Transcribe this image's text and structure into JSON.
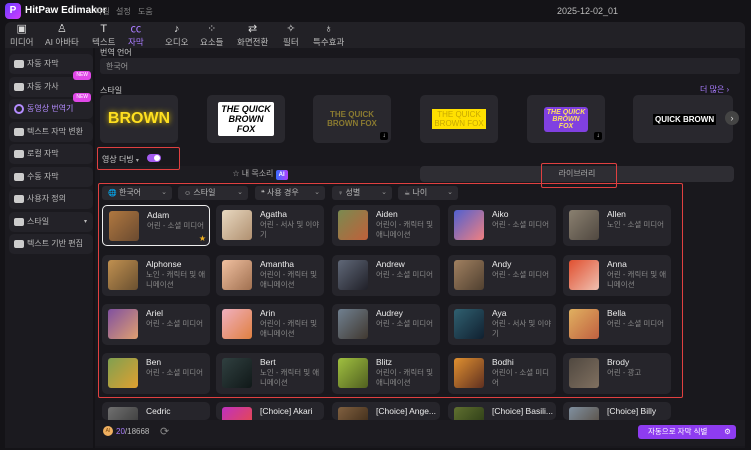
{
  "app": {
    "title": "HitPaw Edimakor",
    "menu": [
      "파일",
      "설정",
      "도움"
    ],
    "project": "2025-12-02_01"
  },
  "toolbar": [
    {
      "label": "미디어",
      "icon": "media-icon"
    },
    {
      "label": "AI 아바타",
      "icon": "avatar-icon"
    },
    {
      "label": "텍스트",
      "icon": "text-icon"
    },
    {
      "label": "자막",
      "icon": "subtitle-icon",
      "active": true
    },
    {
      "label": "오디오",
      "icon": "audio-icon"
    },
    {
      "label": "요소들",
      "icon": "elements-icon"
    },
    {
      "label": "화면전환",
      "icon": "transition-icon"
    },
    {
      "label": "필터",
      "icon": "filter-icon"
    },
    {
      "label": "특수효과",
      "icon": "effects-icon"
    }
  ],
  "sidebar": {
    "items": [
      {
        "label": "자동 자막"
      },
      {
        "label": "자동 가사",
        "badge": "NEW"
      },
      {
        "label": "동영상 번역기",
        "badge": "NEW",
        "active": true
      },
      {
        "label": "텍스트 자막 변환"
      },
      {
        "label": "로컬 자막"
      },
      {
        "label": "수동 자막"
      },
      {
        "label": "사용자 정의"
      },
      {
        "label": "스타일"
      },
      {
        "label": "텍스트 기반 편집"
      }
    ]
  },
  "main": {
    "translate_label": "번역 언어",
    "translate_value": "한국어",
    "style_label": "스타일",
    "more_label": "더 많은",
    "styles": [
      "BROWN",
      "THE QUICK BROWN FOX",
      "THE QUICK BROWN FOX",
      "THE QUICK BROWN FOX",
      "THE QUICK BROWN FOX",
      "QUICK BROWN"
    ],
    "dubbing_label": "영상 더빙",
    "dubbing_on": true,
    "tabs": {
      "my_voice": "내 목소리",
      "ai_badge": "AI",
      "library": "라이브러리"
    },
    "filters": [
      "한국어",
      "스타일",
      "사용 경우",
      "성별",
      "나이"
    ],
    "voices": [
      {
        "name": "Adam",
        "desc": "어린 - 소셜 미디어",
        "c": [
          "#b07840",
          "#6a4a30"
        ],
        "selected": true
      },
      {
        "name": "Agatha",
        "desc": "어린 - 서사 및 이야기",
        "c": [
          "#e8d8c0",
          "#b09070"
        ]
      },
      {
        "name": "Aiden",
        "desc": "어린이 - 캐릭터 및 애니메이션",
        "c": [
          "#7a8a50",
          "#c0603a"
        ]
      },
      {
        "name": "Aiko",
        "desc": "어린 - 소셜 미디어",
        "c": [
          "#5060d0",
          "#f08080"
        ]
      },
      {
        "name": "Allen",
        "desc": "노인 - 소셜 미디어",
        "c": [
          "#8a8070",
          "#504840"
        ]
      },
      {
        "name": "Alphonse",
        "desc": "노인 - 캐릭터 및 애니메이션",
        "c": [
          "#c09050",
          "#6a5030"
        ]
      },
      {
        "name": "Amantha",
        "desc": "어린이 - 캐릭터 및 애니메이션",
        "c": [
          "#f0c0a0",
          "#a07050"
        ]
      },
      {
        "name": "Andrew",
        "desc": "어린 - 소셜 미디어",
        "c": [
          "#606878",
          "#202028"
        ]
      },
      {
        "name": "Andy",
        "desc": "어린 - 소셜 미디어",
        "c": [
          "#a08060",
          "#504030"
        ]
      },
      {
        "name": "Anna",
        "desc": "어린 - 캐릭터 및 애니메이션",
        "c": [
          "#e05030",
          "#f0c0b0"
        ]
      },
      {
        "name": "Ariel",
        "desc": "어린 - 소셜 미디어",
        "c": [
          "#8050a0",
          "#e0a070"
        ]
      },
      {
        "name": "Arin",
        "desc": "어린이 - 캐릭터 및 애니메이션",
        "c": [
          "#f0b0c0",
          "#e08040"
        ]
      },
      {
        "name": "Audrey",
        "desc": "어린 - 소셜 미디어",
        "c": [
          "#708090",
          "#403830"
        ]
      },
      {
        "name": "Aya",
        "desc": "어린 - 서사 및 이야기",
        "c": [
          "#306070",
          "#102030"
        ]
      },
      {
        "name": "Bella",
        "desc": "어린 - 소셜 미디어",
        "c": [
          "#e0b060",
          "#c06040"
        ]
      },
      {
        "name": "Ben",
        "desc": "어린 - 소셜 미디어",
        "c": [
          "#80a050",
          "#e0a030"
        ]
      },
      {
        "name": "Bert",
        "desc": "노인 - 캐릭터 및 애니메이션",
        "c": [
          "#304040",
          "#101818"
        ]
      },
      {
        "name": "Blitz",
        "desc": "어린이 - 캐릭터 및 애니메이션",
        "c": [
          "#a0c040",
          "#506020"
        ]
      },
      {
        "name": "Bodhi",
        "desc": "어린이 - 소셜 미디어",
        "c": [
          "#e09030",
          "#603020"
        ]
      },
      {
        "name": "Brody",
        "desc": "어린 - 광고",
        "c": [
          "#504840",
          "#807060"
        ]
      },
      {
        "name": "Cedric",
        "desc": "",
        "c": [
          "#707070",
          "#303030"
        ]
      },
      {
        "name": "[Choice] Akari",
        "desc": "",
        "c": [
          "#c030c0",
          "#f05030"
        ]
      },
      {
        "name": "[Choice] Ange...",
        "desc": "",
        "c": [
          "#806040",
          "#302010"
        ]
      },
      {
        "name": "[Choice] Basili...",
        "desc": "",
        "c": [
          "#607030",
          "#203010"
        ]
      },
      {
        "name": "[Choice] Billy",
        "desc": "",
        "c": [
          "#8090a0",
          "#504030"
        ]
      }
    ]
  },
  "footer": {
    "used": "20",
    "total": "/18668",
    "auto_label": "자동으로 자막 식별"
  }
}
